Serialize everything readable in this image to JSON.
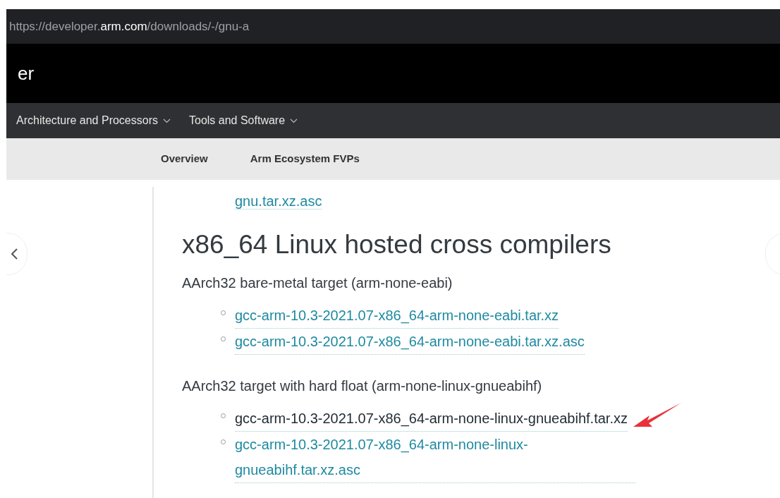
{
  "address_bar": {
    "prefix": "https://developer.",
    "domain": "arm.com",
    "path": "/downloads/-/gnu-a"
  },
  "header": {
    "title": "er"
  },
  "nav": [
    {
      "label": "Architecture and Processors",
      "has_menu": true
    },
    {
      "label": "Tools and Software",
      "has_menu": true
    }
  ],
  "subnav": [
    {
      "label": "Overview"
    },
    {
      "label": "Arm Ecosystem FVPs"
    }
  ],
  "content": {
    "cut_link": "gnu.tar.xz.asc",
    "heading": "x86_64 Linux hosted cross compilers",
    "sections": [
      {
        "label": "AArch32 bare-metal target (arm-none-eabi)",
        "links": [
          {
            "text": "gcc-arm-10.3-2021.07-x86_64-arm-none-eabi.tar.xz",
            "highlighted": false
          },
          {
            "text": "gcc-arm-10.3-2021.07-x86_64-arm-none-eabi.tar.xz.asc",
            "highlighted": false
          }
        ]
      },
      {
        "label": "AArch32 target with hard float (arm-none-linux-gnueabihf)",
        "links": [
          {
            "text": "gcc-arm-10.3-2021.07-x86_64-arm-none-linux-gnueabihf.tar.xz",
            "highlighted": true
          },
          {
            "text": "gcc-arm-10.3-2021.07-x86_64-arm-none-linux-gnueabihf.tar.xz.asc",
            "highlighted": false
          }
        ]
      }
    ]
  }
}
